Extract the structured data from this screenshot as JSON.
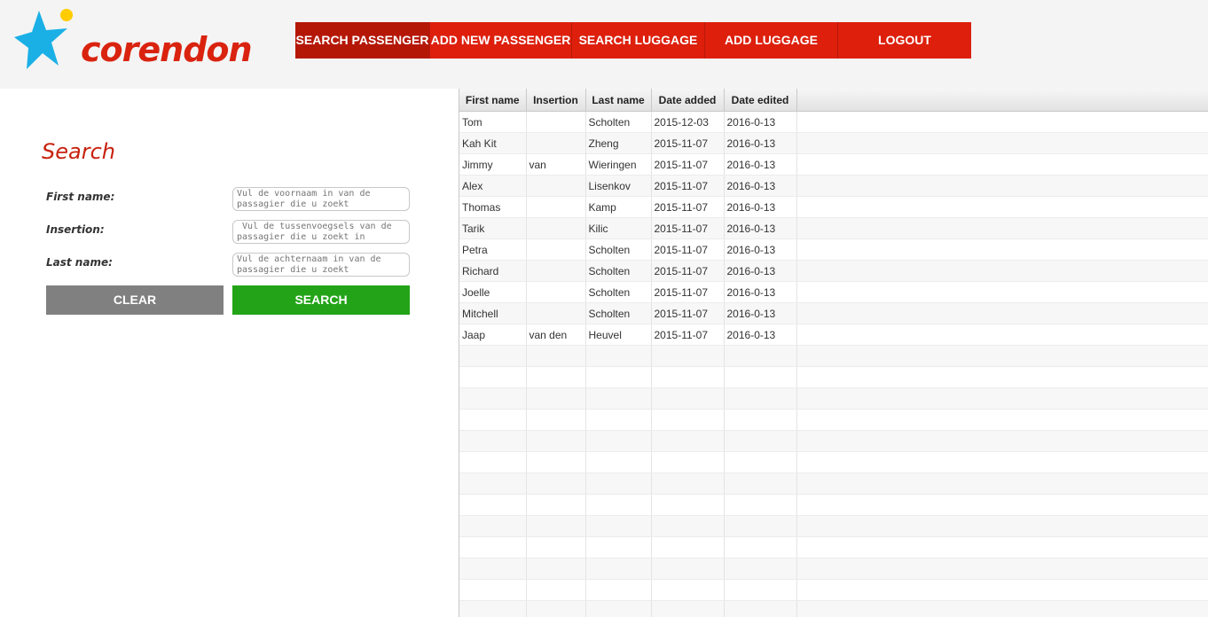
{
  "brand": {
    "name": "corendon",
    "logo_color": "#d9230f",
    "star_color": "#1ab0e6",
    "sun_color": "#ffcc00"
  },
  "nav": {
    "items": [
      {
        "label": "SEARCH PASSENGER",
        "active": true
      },
      {
        "label": "ADD NEW PASSENGER"
      },
      {
        "label": "SEARCH LUGGAGE"
      },
      {
        "label": "ADD LUGGAGE"
      },
      {
        "label": "LOGOUT"
      }
    ]
  },
  "search": {
    "title": "Search",
    "first_name_label": "First name:",
    "first_name_placeholder": "Vul de voornaam in van de passagier die u zoekt",
    "insertion_label": "Insertion:",
    "insertion_placeholder": " Vul de tussenvoegsels van de passagier die u zoekt in",
    "last_name_label": "Last name:",
    "last_name_placeholder": "Vul de achternaam in van de passagier die u zoekt",
    "clear_label": "CLEAR",
    "search_label": "SEARCH"
  },
  "table": {
    "columns": [
      "First name",
      "Insertion",
      "Last name",
      "Date added",
      "Date edited"
    ],
    "rows": [
      [
        "Tom",
        "",
        "Scholten",
        "2015-12-03",
        "2016-0-13"
      ],
      [
        "Kah Kit",
        "",
        "Zheng",
        "2015-11-07",
        "2016-0-13"
      ],
      [
        "Jimmy",
        "van",
        "Wieringen",
        "2015-11-07",
        "2016-0-13"
      ],
      [
        "Alex",
        "",
        "Lisenkov",
        "2015-11-07",
        "2016-0-13"
      ],
      [
        "Thomas",
        "",
        "Kamp",
        "2015-11-07",
        "2016-0-13"
      ],
      [
        "Tarik",
        "",
        "Kilic",
        "2015-11-07",
        "2016-0-13"
      ],
      [
        "Petra",
        "",
        "Scholten",
        "2015-11-07",
        "2016-0-13"
      ],
      [
        "Richard",
        "",
        "Scholten",
        "2015-11-07",
        "2016-0-13"
      ],
      [
        "Joelle",
        "",
        "Scholten",
        "2015-11-07",
        "2016-0-13"
      ],
      [
        "Mitchell",
        "",
        "Scholten",
        "2015-11-07",
        "2016-0-13"
      ],
      [
        "Jaap",
        "van den",
        "Heuvel",
        "2015-11-07",
        "2016-0-13"
      ]
    ]
  }
}
